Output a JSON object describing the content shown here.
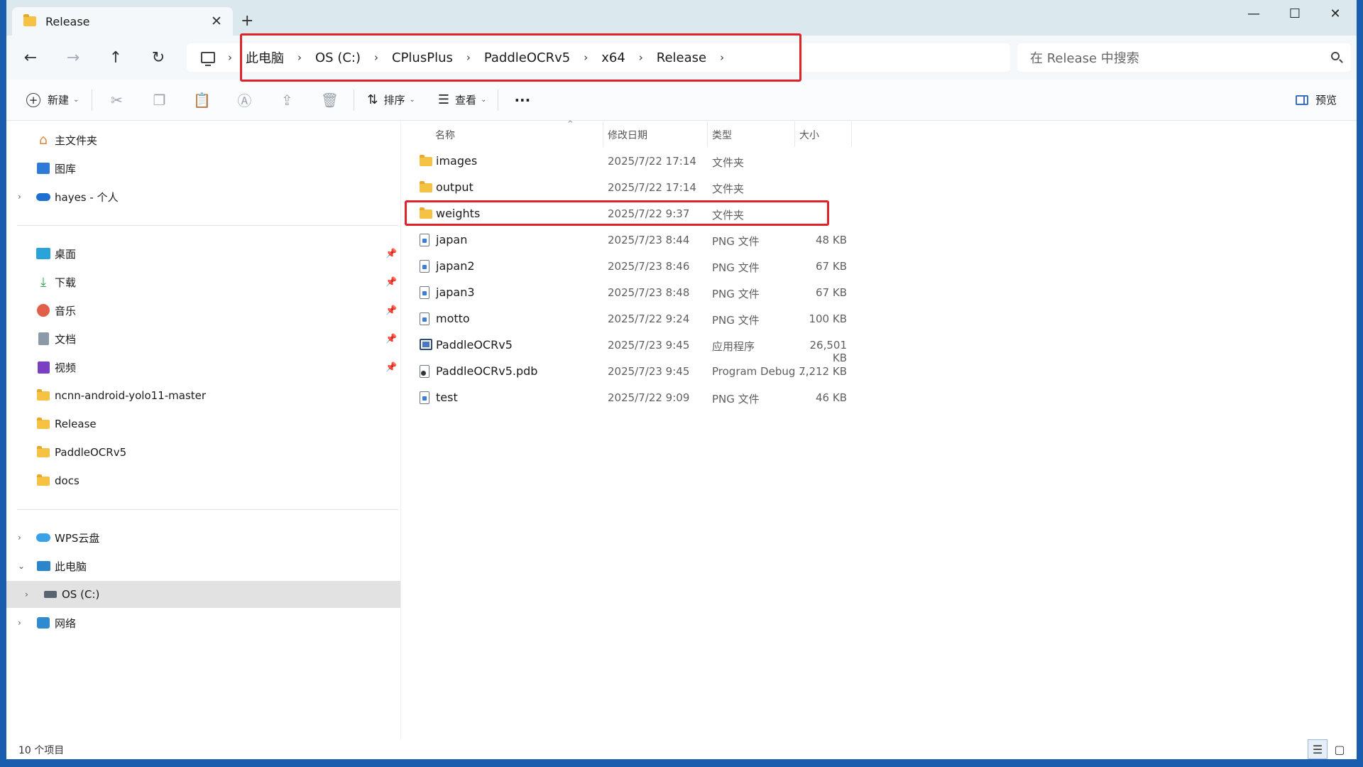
{
  "window": {
    "tab_title": "Release",
    "tab_close": "✕",
    "new_tab": "+",
    "minimize": "—",
    "maximize": "☐",
    "close": "✕"
  },
  "nav": {
    "back": "←",
    "forward": "→",
    "up": "↑",
    "refresh": "↻",
    "breadcrumb": [
      "此电脑",
      "OS (C:)",
      "CPlusPlus",
      "PaddleOCRv5",
      "x64",
      "Release"
    ],
    "search_placeholder": "在 Release 中搜索"
  },
  "toolbar": {
    "new_label": "新建",
    "sort_label": "排序",
    "view_label": "查看",
    "more_label": "···",
    "preview_label": "预览"
  },
  "sidebar": {
    "quick": [
      {
        "label": "主文件夹",
        "icon": "home-icon"
      },
      {
        "label": "图库",
        "icon": "gallery-icon"
      },
      {
        "label": "hayes - 个人",
        "icon": "onedrive-cloud-icon"
      }
    ],
    "pinned": [
      {
        "label": "桌面",
        "icon": "desktop-icon"
      },
      {
        "label": "下载",
        "icon": "download-icon"
      },
      {
        "label": "音乐",
        "icon": "music-icon"
      },
      {
        "label": "文档",
        "icon": "document-icon"
      },
      {
        "label": "视频",
        "icon": "video-icon"
      },
      {
        "label": "ncnn-android-yolo11-master",
        "icon": "folder-icon"
      },
      {
        "label": "Release",
        "icon": "folder-icon"
      },
      {
        "label": "PaddleOCRv5",
        "icon": "folder-icon"
      },
      {
        "label": "docs",
        "icon": "folder-icon"
      }
    ],
    "drives": [
      {
        "label": "WPS云盘",
        "icon": "wps-cloud-icon"
      },
      {
        "label": "此电脑",
        "icon": "computer-icon"
      },
      {
        "label": "OS (C:)",
        "icon": "drive-icon"
      },
      {
        "label": "网络",
        "icon": "network-icon"
      }
    ]
  },
  "columns": {
    "name": "名称",
    "date": "修改日期",
    "type": "类型",
    "size": "大小"
  },
  "files": [
    {
      "name": "images",
      "date": "2025/7/22 17:14",
      "type": "文件夹",
      "size": "",
      "icon": "folder-icon"
    },
    {
      "name": "output",
      "date": "2025/7/22 17:14",
      "type": "文件夹",
      "size": "",
      "icon": "folder-icon"
    },
    {
      "name": "weights",
      "date": "2025/7/22 9:37",
      "type": "文件夹",
      "size": "",
      "icon": "folder-icon"
    },
    {
      "name": "japan",
      "date": "2025/7/23 8:44",
      "type": "PNG 文件",
      "size": "48 KB",
      "icon": "png-file-icon"
    },
    {
      "name": "japan2",
      "date": "2025/7/23 8:46",
      "type": "PNG 文件",
      "size": "67 KB",
      "icon": "png-file-icon"
    },
    {
      "name": "japan3",
      "date": "2025/7/23 8:48",
      "type": "PNG 文件",
      "size": "67 KB",
      "icon": "png-file-icon"
    },
    {
      "name": "motto",
      "date": "2025/7/22 9:24",
      "type": "PNG 文件",
      "size": "100 KB",
      "icon": "png-file-icon"
    },
    {
      "name": "PaddleOCRv5",
      "date": "2025/7/23 9:45",
      "type": "应用程序",
      "size": "26,501 KB",
      "icon": "exe-file-icon"
    },
    {
      "name": "PaddleOCRv5.pdb",
      "date": "2025/7/23 9:45",
      "type": "Program Debug ...",
      "size": "7,212 KB",
      "icon": "pdb-file-icon"
    },
    {
      "name": "test",
      "date": "2025/7/22 9:09",
      "type": "PNG 文件",
      "size": "46 KB",
      "icon": "png-file-icon"
    }
  ],
  "status": {
    "count": "10 个项目"
  },
  "colors": {
    "highlight_red": "#e0222a",
    "folder_yellow": "#f6c244",
    "titlebar_bg": "#dbe9ee",
    "selected_bg": "#e2e2e2"
  }
}
